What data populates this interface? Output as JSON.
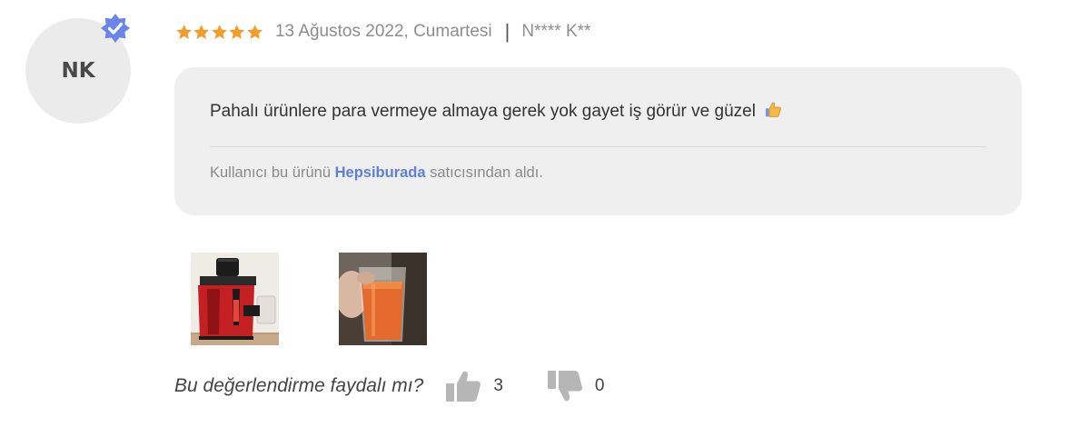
{
  "review": {
    "avatar_initials": "NK",
    "rating": 5,
    "max_rating": 5,
    "date": "13 Ağustos 2022, Cumartesi",
    "separator": "|",
    "author": "N**** K**",
    "comment": "Pahalı ürünlere para vermeye almaya gerek yok gayet iş görür ve güzel",
    "comment_emoji_icon": "thumbs-up-emoji-icon",
    "seller_prefix": "Kullanıcı bu ürünü",
    "seller_name": "Hepsiburada",
    "seller_suffix": "satıcısından aldı."
  },
  "photos": [
    {
      "icon": "juicer-photo"
    },
    {
      "icon": "carrot-juice-glass-photo"
    }
  ],
  "helpful": {
    "question": "Bu değerlendirme faydalı mı?",
    "likes": "3",
    "dislikes": "0"
  },
  "colors": {
    "star": "#f39c27",
    "verified_badge": "#6b84e8",
    "seller_link": "#5f7fd8",
    "bubble_bg": "#efefef",
    "avatar_bg": "#ebebeb"
  }
}
